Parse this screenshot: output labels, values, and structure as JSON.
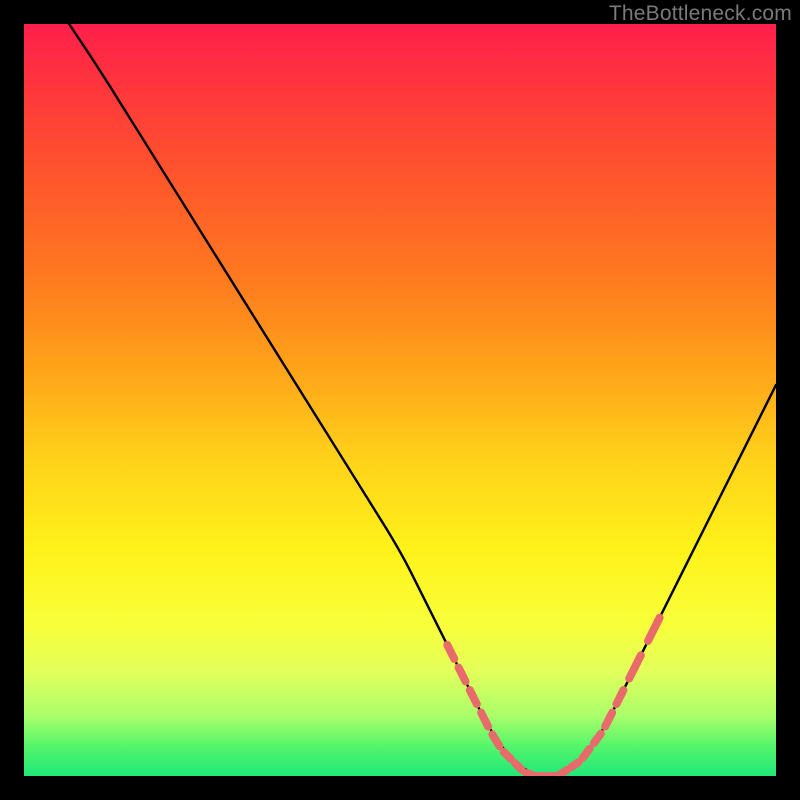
{
  "watermark": "TheBottleneck.com",
  "chart_data": {
    "type": "line",
    "title": "",
    "xlabel": "",
    "ylabel": "",
    "xlim": [
      0,
      100
    ],
    "ylim": [
      0,
      100
    ],
    "series": [
      {
        "name": "bottleneck-curve",
        "x": [
          6,
          10,
          15,
          20,
          25,
          30,
          35,
          40,
          45,
          50,
          53,
          56,
          59,
          62,
          65,
          68,
          71,
          74,
          77,
          80,
          85,
          90,
          95,
          100
        ],
        "y": [
          100,
          94,
          86,
          78,
          70,
          62,
          54,
          46,
          38,
          30,
          24,
          18,
          12,
          6,
          2,
          0,
          0,
          2,
          6,
          12,
          22,
          32,
          42,
          52
        ]
      }
    ],
    "highlight_segments": [
      {
        "name": "left-dash",
        "x": [
          56,
          57.5,
          59,
          60.5,
          62,
          63.5,
          65
        ],
        "y": [
          18,
          15,
          12,
          9,
          6,
          3.5,
          2
        ]
      },
      {
        "name": "bottom-dash",
        "x": [
          65,
          66.5,
          68,
          69.5,
          71,
          72.5,
          74
        ],
        "y": [
          2,
          0.5,
          0,
          0,
          0,
          1,
          2
        ]
      },
      {
        "name": "right-dash",
        "x": [
          74,
          75.5,
          77,
          78.5,
          80,
          82.5,
          85
        ],
        "y": [
          2,
          4,
          6,
          9,
          12,
          17,
          22
        ]
      }
    ],
    "colors": {
      "curve": "#000000",
      "highlight": "#e86a6a",
      "gradient_top": "#ff1f4b",
      "gradient_mid": "#ffd21a",
      "gradient_bottom": "#1fe87a"
    }
  }
}
